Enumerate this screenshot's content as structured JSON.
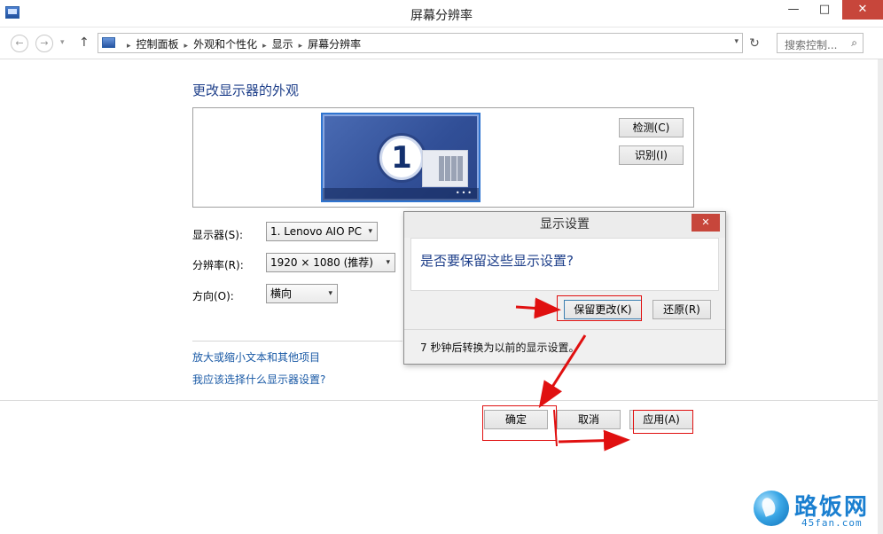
{
  "window": {
    "title": "屏幕分辨率",
    "minimize": "—",
    "maximize": "□",
    "close": "✕"
  },
  "addressbar": {
    "back": "←",
    "forward": "→",
    "history": "▾",
    "up": "↑",
    "crumbs": [
      "控制面板",
      "外观和个性化",
      "显示",
      "屏幕分辨率"
    ],
    "crumb_sep": "▸",
    "dropdown": "▾",
    "refresh": "↻",
    "search_placeholder": "搜索控制...",
    "search_icon": "⌕"
  },
  "main": {
    "heading": "更改显示器的外观",
    "monitor_number": "1",
    "monitor_dots": "•••",
    "detect_button": "检测(C)",
    "identify_button": "识别(I)",
    "display_label": "显示器(S):",
    "display_value": "1. Lenovo AIO PC",
    "resolution_label": "分辨率(R):",
    "resolution_value": "1920 × 1080 (推荐)",
    "orientation_label": "方向(O):",
    "orientation_value": "横向",
    "select_arrow": "▾",
    "link_text_size": "放大或缩小文本和其他项目",
    "link_which_settings": "我应该选择什么显示器设置?",
    "ok_button": "确定",
    "cancel_button": "取消",
    "apply_button": "应用(A)"
  },
  "dialog": {
    "title": "显示设置",
    "close": "✕",
    "question": "是否要保留这些显示设置?",
    "keep_button": "保留更改(K)",
    "revert_button": "还原(R)",
    "countdown": "7 秒钟后转换为以前的显示设置。"
  },
  "watermark": {
    "name": "路饭网",
    "url": "45fan.com"
  },
  "colors": {
    "accent_blue": "#1e3f8a",
    "link_blue": "#1a5aa6",
    "close_red": "#c7463b",
    "annotation_red": "#e01010"
  }
}
